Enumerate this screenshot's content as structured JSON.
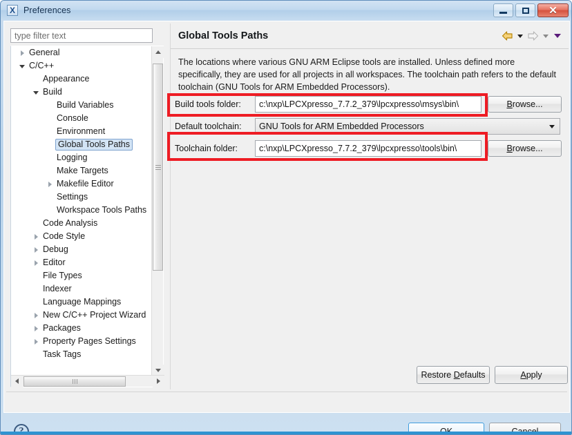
{
  "window": {
    "title": "Preferences",
    "icon": "eclipse-x-icon",
    "minimize_label": "Minimize",
    "maximize_label": "Maximize",
    "close_label": "Close",
    "close_glyph": "✕"
  },
  "sidebar": {
    "filter": {
      "value": "",
      "placeholder": "type filter text"
    },
    "items": [
      {
        "label": "General",
        "indent": 0,
        "twisty": "collapsed",
        "selected": false
      },
      {
        "label": "C/C++",
        "indent": 0,
        "twisty": "expanded",
        "selected": false
      },
      {
        "label": "Appearance",
        "indent": 1,
        "twisty": "none",
        "selected": false
      },
      {
        "label": "Build",
        "indent": 1,
        "twisty": "expanded",
        "selected": false
      },
      {
        "label": "Build Variables",
        "indent": 2,
        "twisty": "none",
        "selected": false
      },
      {
        "label": "Console",
        "indent": 2,
        "twisty": "none",
        "selected": false
      },
      {
        "label": "Environment",
        "indent": 2,
        "twisty": "none",
        "selected": false
      },
      {
        "label": "Global Tools Paths",
        "indent": 2,
        "twisty": "none",
        "selected": true
      },
      {
        "label": "Logging",
        "indent": 2,
        "twisty": "none",
        "selected": false
      },
      {
        "label": "Make Targets",
        "indent": 2,
        "twisty": "none",
        "selected": false
      },
      {
        "label": "Makefile Editor",
        "indent": 2,
        "twisty": "collapsed",
        "selected": false
      },
      {
        "label": "Settings",
        "indent": 2,
        "twisty": "none",
        "selected": false
      },
      {
        "label": "Workspace Tools Paths",
        "indent": 2,
        "twisty": "none",
        "selected": false
      },
      {
        "label": "Code Analysis",
        "indent": 1,
        "twisty": "none",
        "selected": false
      },
      {
        "label": "Code Style",
        "indent": 1,
        "twisty": "collapsed",
        "selected": false
      },
      {
        "label": "Debug",
        "indent": 1,
        "twisty": "collapsed",
        "selected": false
      },
      {
        "label": "Editor",
        "indent": 1,
        "twisty": "collapsed",
        "selected": false
      },
      {
        "label": "File Types",
        "indent": 1,
        "twisty": "none",
        "selected": false
      },
      {
        "label": "Indexer",
        "indent": 1,
        "twisty": "none",
        "selected": false
      },
      {
        "label": "Language Mappings",
        "indent": 1,
        "twisty": "none",
        "selected": false
      },
      {
        "label": "New C/C++ Project Wizard",
        "indent": 1,
        "twisty": "collapsed",
        "selected": false
      },
      {
        "label": "Packages",
        "indent": 1,
        "twisty": "collapsed",
        "selected": false
      },
      {
        "label": "Property Pages Settings",
        "indent": 1,
        "twisty": "collapsed",
        "selected": false
      },
      {
        "label": "Task Tags",
        "indent": 1,
        "twisty": "none",
        "selected": false
      }
    ]
  },
  "page": {
    "title": "Global Tools Paths",
    "description": "The locations where various GNU ARM Eclipse tools are installed. Unless defined more specifically, they are used for all projects in all workspaces. The toolchain path refers to the default toolchain (GNU Tools for ARM Embedded Processors).",
    "nav": {
      "back_icon": "back-arrow-icon",
      "back_dropdown_icon": "chevron-down-icon",
      "forward_icon": "forward-arrow-icon",
      "forward_dropdown_icon": "chevron-down-icon",
      "menu_dropdown_icon": "chevron-down-icon"
    },
    "fields": {
      "build_tools": {
        "label": "Build tools folder:",
        "value": "c:\\nxp\\LPCXpresso_7.7.2_379\\lpcxpresso\\msys\\bin\\",
        "browse_label_pre": "",
        "browse_accel": "B",
        "browse_label_post": "rowse...",
        "highlighted": true
      },
      "default_toolchain": {
        "label": "Default toolchain:",
        "value": "GNU Tools for ARM Embedded Processors",
        "options": [
          "GNU Tools for ARM Embedded Processors"
        ],
        "highlighted": false
      },
      "toolchain_folder": {
        "label": "Toolchain folder:",
        "value": "c:\\nxp\\LPCXpresso_7.7.2_379\\lpcxpresso\\tools\\bin\\",
        "browse_label_pre": "",
        "browse_accel": "B",
        "browse_label_post": "rowse...",
        "highlighted": true
      }
    },
    "restore_defaults": {
      "pre": "Restore ",
      "accel": "D",
      "post": "efaults"
    },
    "apply": {
      "pre": "",
      "accel": "A",
      "post": "pply"
    }
  },
  "footer": {
    "help_icon": "help-question-icon",
    "help_glyph": "?",
    "ok": "OK",
    "cancel": "Cancel"
  },
  "colors": {
    "annotation": "#ee1c24",
    "accent": "#2e93d1",
    "selection": "#d3e4f5"
  }
}
